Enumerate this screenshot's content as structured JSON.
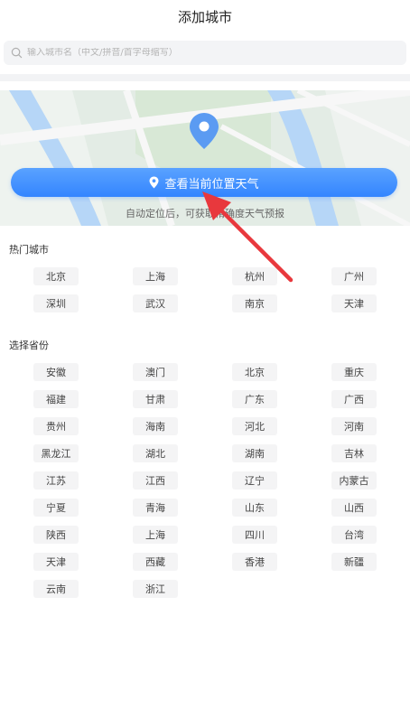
{
  "header": {
    "title": "添加城市"
  },
  "search": {
    "placeholder": "输入城市名（中文/拼音/首字母缩写）"
  },
  "location": {
    "button_label": "查看当前位置天气",
    "hint": "自动定位后，可获取精确度天气预报"
  },
  "hot_cities": {
    "title": "热门城市",
    "items": [
      "北京",
      "上海",
      "杭州",
      "广州",
      "深圳",
      "武汉",
      "南京",
      "天津"
    ]
  },
  "provinces": {
    "title": "选择省份",
    "items": [
      "安徽",
      "澳门",
      "北京",
      "重庆",
      "福建",
      "甘肃",
      "广东",
      "广西",
      "贵州",
      "海南",
      "河北",
      "河南",
      "黑龙江",
      "湖北",
      "湖南",
      "吉林",
      "江苏",
      "江西",
      "辽宁",
      "内蒙古",
      "宁夏",
      "青海",
      "山东",
      "山西",
      "陕西",
      "上海",
      "四川",
      "台湾",
      "天津",
      "西藏",
      "香港",
      "新疆",
      "云南",
      "浙江"
    ]
  },
  "colors": {
    "accent": "#3385ff",
    "arrow": "#e8383d",
    "chip_bg": "#f4f4f5"
  },
  "icons": {
    "search": "search-icon",
    "pin": "map-pin-icon",
    "locate": "location-icon"
  }
}
